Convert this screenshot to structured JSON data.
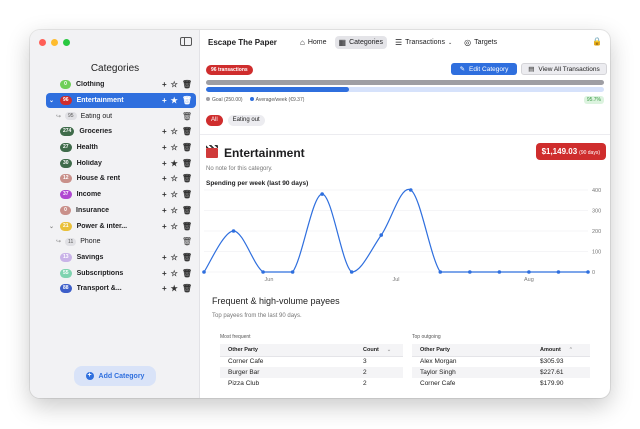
{
  "window": {
    "title": "Escape The Paper"
  },
  "colors": {
    "accent": "#2f6fde",
    "danger": "#cf2d2d",
    "sidebar_bg": "#f2f2f4"
  },
  "sidebar": {
    "title": "Categories",
    "add_label": "Add Category",
    "items": [
      {
        "name": "Clothing",
        "badge": "0",
        "badge_color": "#6fcf59",
        "favorite": false,
        "expanded": false,
        "selected": false
      },
      {
        "name": "Entertainment",
        "badge": "96",
        "badge_color": "#cf2d2d",
        "favorite": true,
        "expanded": true,
        "selected": true
      },
      {
        "name": "Eating out",
        "badge": "95",
        "child": true
      },
      {
        "name": "Groceries",
        "badge": "274",
        "badge_color": "#3f6b4a",
        "favorite": false
      },
      {
        "name": "Health",
        "badge": "27",
        "badge_color": "#3f6b4a",
        "favorite": false
      },
      {
        "name": "Holiday",
        "badge": "30",
        "badge_color": "#3f6b4a",
        "favorite": true
      },
      {
        "name": "House & rent",
        "badge": "12",
        "badge_color": "#c9908a",
        "favorite": false
      },
      {
        "name": "Income",
        "badge": "37",
        "badge_color": "#b048d2",
        "favorite": false
      },
      {
        "name": "Insurance",
        "badge": "0",
        "badge_color": "#c9908a",
        "favorite": false
      },
      {
        "name": "Power & inter...",
        "badge": "21",
        "badge_color": "#e9c03a",
        "favorite": false,
        "expanded": true
      },
      {
        "name": "Phone",
        "badge": "11",
        "child": true
      },
      {
        "name": "Savings",
        "badge": "13",
        "badge_color": "#c9b3e8",
        "favorite": false
      },
      {
        "name": "Subscriptions",
        "badge": "55",
        "badge_color": "#7fd3b0",
        "favorite": false
      },
      {
        "name": "Transport &...",
        "badge": "88",
        "badge_color": "#3d5ec9",
        "favorite": true
      }
    ]
  },
  "toolbar": {
    "home": "Home",
    "categories": "Categories",
    "transactions": "Transactions",
    "targets": "Targets"
  },
  "header": {
    "tx_badge": "96 transactions",
    "edit_label": "Edit Category",
    "view_label": "View All Transactions",
    "progress_fraction": 0.36,
    "legend_goal": "Goal (250.00)",
    "legend_avg": "Average/week (€9.37)",
    "pct": "95.7%",
    "chips": [
      "All",
      "Eating out"
    ]
  },
  "category": {
    "title": "Entertainment",
    "note": "No note for this category.",
    "total": "$1,149.03",
    "total_period": "(90 days)"
  },
  "chart_data": {
    "type": "line",
    "title": "Spending per week (last 90 days)",
    "x": [
      0,
      1,
      2,
      3,
      4,
      5,
      6,
      7,
      8,
      9,
      10,
      11,
      12,
      13
    ],
    "values": [
      0,
      200,
      0,
      0,
      380,
      0,
      180,
      400,
      0,
      0,
      0,
      0,
      0,
      0
    ],
    "ylim": [
      0,
      400
    ],
    "y_ticks": [
      "400",
      "300",
      "200",
      "100",
      "0"
    ],
    "x_ticks": [
      {
        "label": "Jun",
        "at": 2.2
      },
      {
        "label": "Jul",
        "at": 6.5
      },
      {
        "label": "Aug",
        "at": 11.0
      }
    ],
    "line_color": "#2f6fde",
    "grid": true
  },
  "payees": {
    "title": "Frequent & high-volume payees",
    "subtitle": "Top payees from the last 90 days.",
    "frequent": {
      "caption": "Most frequent",
      "headers": [
        "Other Party",
        "Count"
      ],
      "rows": [
        [
          "Corner Cafe",
          "3"
        ],
        [
          "Burger Bar",
          "2"
        ],
        [
          "Pizza Club",
          "2"
        ]
      ]
    },
    "outgoing": {
      "caption": "Top outgoing",
      "headers": [
        "Other Party",
        "Amount"
      ],
      "rows": [
        [
          "Alex Morgan",
          "$305.93"
        ],
        [
          "Taylor Singh",
          "$227.61"
        ],
        [
          "Corner Cafe",
          "$179.90"
        ]
      ]
    }
  }
}
